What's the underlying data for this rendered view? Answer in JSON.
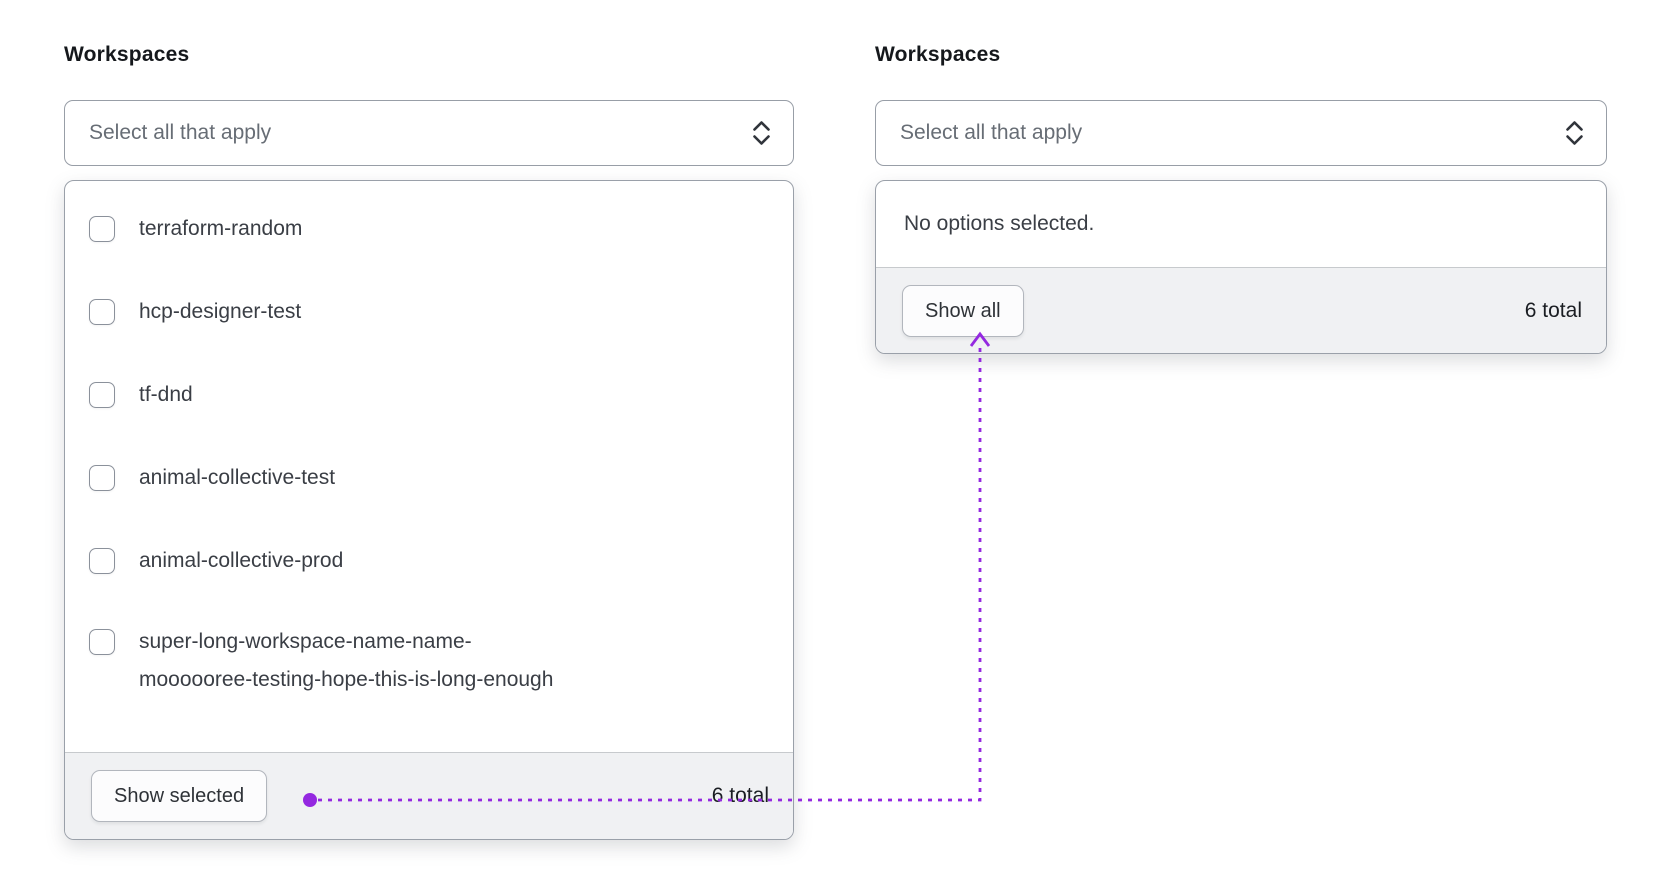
{
  "left_panel": {
    "label": "Workspaces",
    "select": {
      "placeholder": "Select all that apply",
      "icon": "chevron-up-down"
    },
    "options": [
      {
        "label": "terraform-random",
        "checked": false
      },
      {
        "label": "hcp-designer-test",
        "checked": false
      },
      {
        "label": "tf-dnd",
        "checked": false
      },
      {
        "label": "animal-collective-test",
        "checked": false
      },
      {
        "label": "animal-collective-prod",
        "checked": false
      },
      {
        "label_line1": "super-long-workspace-name-name-",
        "label_line2": "moooooree-testing-hope-this-is-long-enough",
        "checked": false
      }
    ],
    "footer": {
      "button_label": "Show selected",
      "total_label": "6 total"
    }
  },
  "right_panel": {
    "label": "Workspaces",
    "select": {
      "placeholder": "Select all that apply",
      "icon": "chevron-up-down"
    },
    "empty_message": "No options selected.",
    "footer": {
      "button_label": "Show all",
      "total_label": "6 total"
    }
  },
  "annotation": {
    "color": "#9428e0",
    "connects": "show-selected-button to show-all-button"
  },
  "colors": {
    "footer_background": "#f0f1f3",
    "border": "#9aa0a9",
    "text_primary": "#3a3e45",
    "placeholder": "#676d75"
  }
}
